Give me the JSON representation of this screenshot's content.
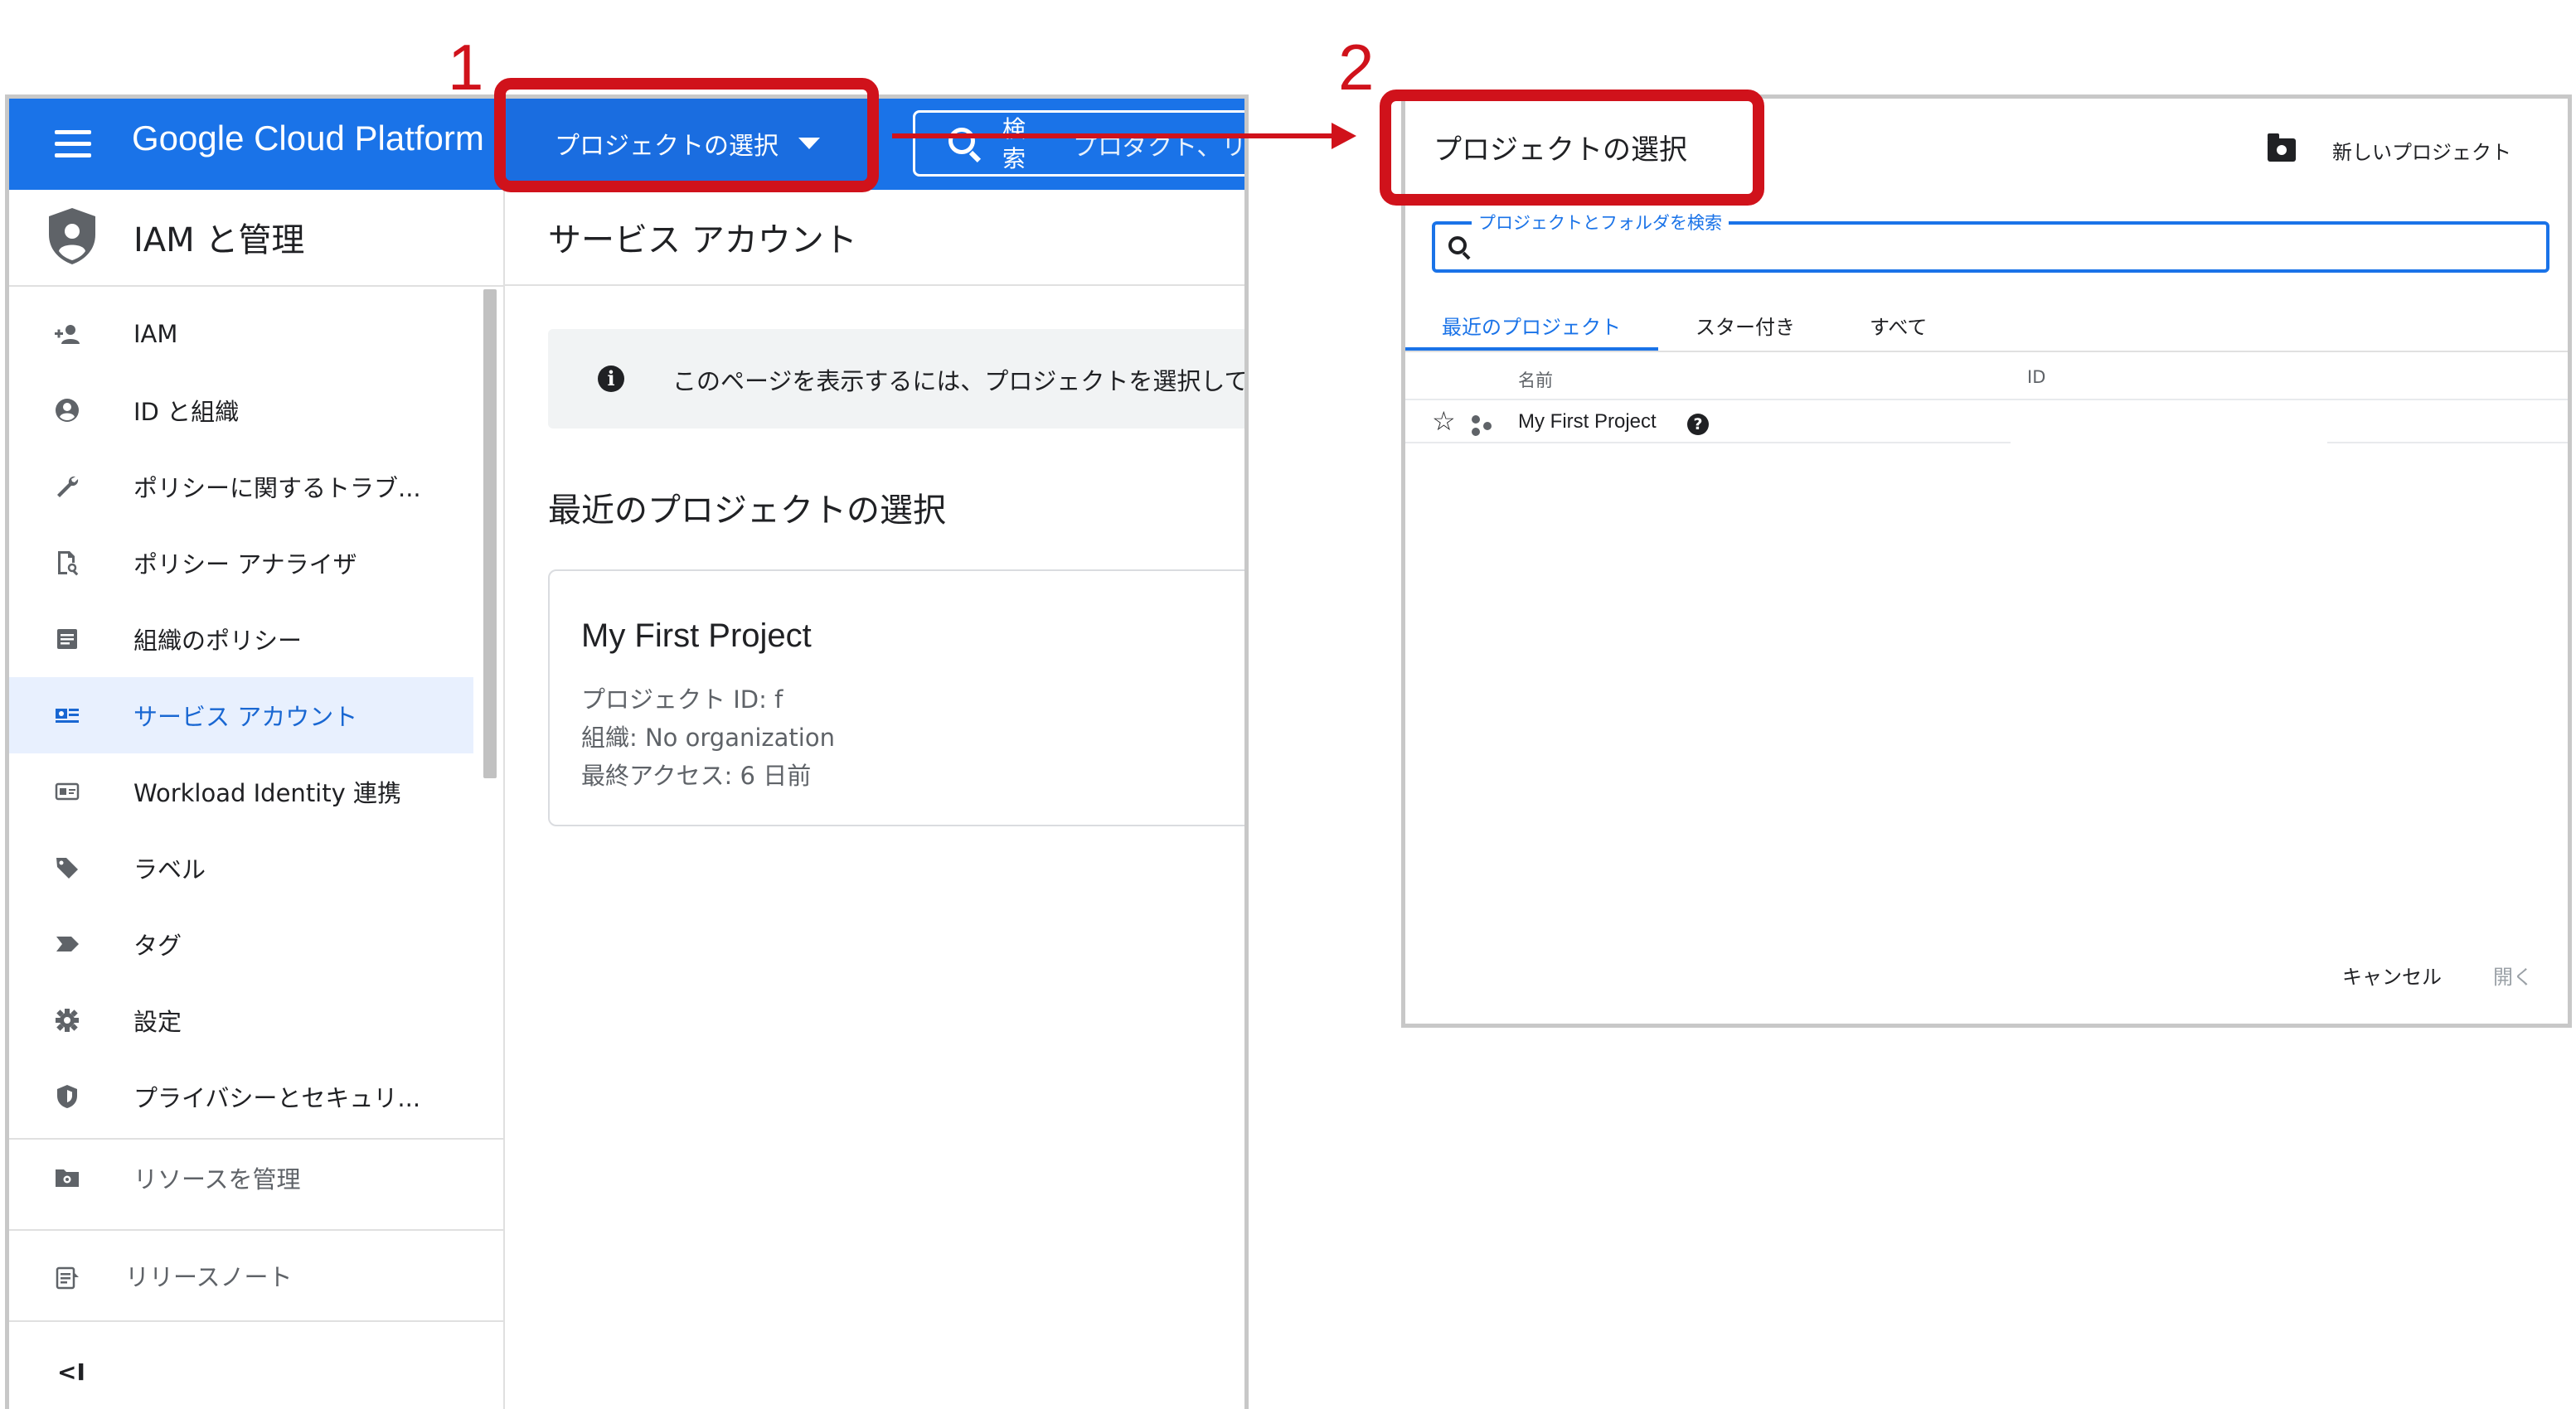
{
  "steps": {
    "step1": "1",
    "step2": "2"
  },
  "topbar": {
    "brand": "Google Cloud Platform",
    "project_selector_label": "プロジェクトの選択",
    "search_label": "検索",
    "search_placeholder": "プロダクト、リ"
  },
  "sidebar": {
    "title": "IAM と管理",
    "items": [
      {
        "label": "IAM",
        "icon": "add-person-icon"
      },
      {
        "label": "ID と組織",
        "icon": "account-circle-icon"
      },
      {
        "label": "ポリシーに関するトラブ...",
        "icon": "wrench-icon"
      },
      {
        "label": "ポリシー アナライザ",
        "icon": "document-search-icon"
      },
      {
        "label": "組織のポリシー",
        "icon": "list-document-icon"
      },
      {
        "label": "サービス アカウント",
        "icon": "service-account-icon",
        "active": true
      },
      {
        "label": "Workload Identity 連携",
        "icon": "id-card-icon"
      },
      {
        "label": "ラベル",
        "icon": "label-tag-icon"
      },
      {
        "label": "タグ",
        "icon": "tag-arrow-icon"
      },
      {
        "label": "設定",
        "icon": "gear-icon"
      },
      {
        "label": "プライバシーとセキュリ...",
        "icon": "shield-icon"
      }
    ],
    "manage_resources": "リソースを管理",
    "release_notes": "リリースノート",
    "collapse": "<I"
  },
  "main": {
    "title": "サービス アカウント",
    "info_text": "このページを表示するには、プロジェクトを選択してください",
    "recent_title": "最近のプロジェクトの選択",
    "card": {
      "name": "My First Project",
      "project_id": "プロジェクト ID: f",
      "org": "組織: No organization",
      "last_access": "最終アクセス: 6 日前"
    }
  },
  "dialog": {
    "title": "プロジェクトの選択",
    "new_project": "新しいプロジェクト",
    "search_label": "プロジェクトとフォルダを検索",
    "tabs": [
      "最近のプロジェクト",
      "スター付き",
      "すべて"
    ],
    "columns": {
      "name": "名前",
      "id": "ID"
    },
    "rows": [
      {
        "name": "My First Project"
      }
    ],
    "cancel": "キャンセル",
    "open": "開く"
  },
  "colors": {
    "brand_blue": "#1a73e8",
    "callout_red": "#d0121b",
    "active_bg": "#e8f0fe"
  }
}
